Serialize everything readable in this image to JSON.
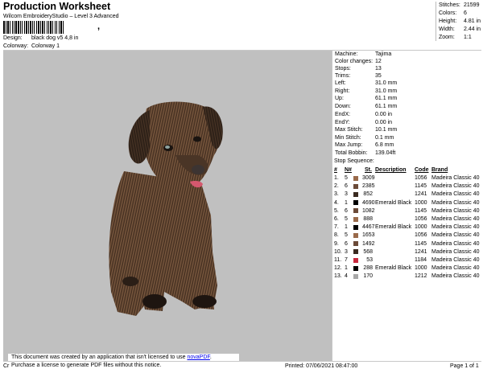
{
  "header": {
    "title": "Production Worksheet",
    "subtitle": "Wilcom EmbroideryStudio – Level 3 Advanced",
    "barcode_tail": ",",
    "design_label": "Design:",
    "design_value": "black dog v5 4,8 in",
    "colorway_label": "Colorway:",
    "colorway_value": "Colorway 1"
  },
  "stats": [
    {
      "label": "Stitches:",
      "value": "21599"
    },
    {
      "label": "Colors:",
      "value": "6"
    },
    {
      "label": "Height:",
      "value": "4.81 in"
    },
    {
      "label": "Width:",
      "value": "2.44 in"
    },
    {
      "label": "Zoom:",
      "value": "1:1"
    }
  ],
  "properties": [
    {
      "label": "Machine:",
      "value": "Tajima"
    },
    {
      "label": "Color changes:",
      "value": "12"
    },
    {
      "label": "Stops:",
      "value": "13"
    },
    {
      "label": "Trims:",
      "value": "35"
    },
    {
      "label": "Left:",
      "value": "31.0 mm"
    },
    {
      "label": "Right:",
      "value": "31.0 mm"
    },
    {
      "label": "Up:",
      "value": "61.1 mm"
    },
    {
      "label": "Down:",
      "value": "61.1 mm"
    },
    {
      "label": "EndX:",
      "value": "0.00 in"
    },
    {
      "label": "EndY:",
      "value": "0.00 in"
    },
    {
      "label": "Max Stitch:",
      "value": "10.1 mm"
    },
    {
      "label": "Min Stitch:",
      "value": "0.1 mm"
    },
    {
      "label": "Max Jump:",
      "value": "6.8 mm"
    },
    {
      "label": "Total Bobbin:",
      "value": "139.04ft"
    }
  ],
  "stop_sequence": {
    "heading": "Stop Sequence:",
    "columns": {
      "num": "#",
      "n": "N#",
      "st": "St.",
      "desc": "Description",
      "code": "Code",
      "brand": "Brand"
    },
    "rows": [
      {
        "num": "1.",
        "n": "5",
        "color": "#9a6a4a",
        "st": "3009",
        "desc": "",
        "code": "1056",
        "brand": "Madeira Classic 40"
      },
      {
        "num": "2.",
        "n": "6",
        "color": "#6b4a38",
        "st": "2385",
        "desc": "",
        "code": "1145",
        "brand": "Madeira Classic 40"
      },
      {
        "num": "3.",
        "n": "3",
        "color": "#3a2a20",
        "st": "852",
        "desc": "",
        "code": "1241",
        "brand": "Madeira Classic 40"
      },
      {
        "num": "4.",
        "n": "1",
        "color": "#000000",
        "st": "4690",
        "desc": "Emerald Black",
        "code": "1000",
        "brand": "Madeira Classic 40"
      },
      {
        "num": "5.",
        "n": "6",
        "color": "#6b4a38",
        "st": "1082",
        "desc": "",
        "code": "1145",
        "brand": "Madeira Classic 40"
      },
      {
        "num": "6.",
        "n": "5",
        "color": "#9a6a4a",
        "st": "888",
        "desc": "",
        "code": "1056",
        "brand": "Madeira Classic 40"
      },
      {
        "num": "7.",
        "n": "1",
        "color": "#000000",
        "st": "4467",
        "desc": "Emerald Black",
        "code": "1000",
        "brand": "Madeira Classic 40"
      },
      {
        "num": "8.",
        "n": "5",
        "color": "#9a6a4a",
        "st": "1653",
        "desc": "",
        "code": "1056",
        "brand": "Madeira Classic 40"
      },
      {
        "num": "9.",
        "n": "6",
        "color": "#6b4a38",
        "st": "1492",
        "desc": "",
        "code": "1145",
        "brand": "Madeira Classic 40"
      },
      {
        "num": "10.",
        "n": "3",
        "color": "#3a2a20",
        "st": "568",
        "desc": "",
        "code": "1241",
        "brand": "Madeira Classic 40"
      },
      {
        "num": "11.",
        "n": "7",
        "color": "#c8283c",
        "st": "53",
        "desc": "",
        "code": "1184",
        "brand": "Madeira Classic 40"
      },
      {
        "num": "12.",
        "n": "1",
        "color": "#000000",
        "st": "288",
        "desc": "Emerald Black",
        "code": "1000",
        "brand": "Madeira Classic 40"
      },
      {
        "num": "13.",
        "n": "4",
        "color": "#a8a8a8",
        "st": "170",
        "desc": "",
        "code": "1212",
        "brand": "Madeira Classic 40"
      }
    ]
  },
  "notice": {
    "line1_prefix": "This document was created by an application that isn't licensed to use ",
    "line1_link": "novaPDF",
    "line1_suffix": ".",
    "line2": "Purchase a license to generate PDF files without this notice."
  },
  "footer": {
    "cr": "Cr",
    "printed": "Printed: 07/06/2021 08:47:00",
    "page": "Page 1 of 1"
  }
}
